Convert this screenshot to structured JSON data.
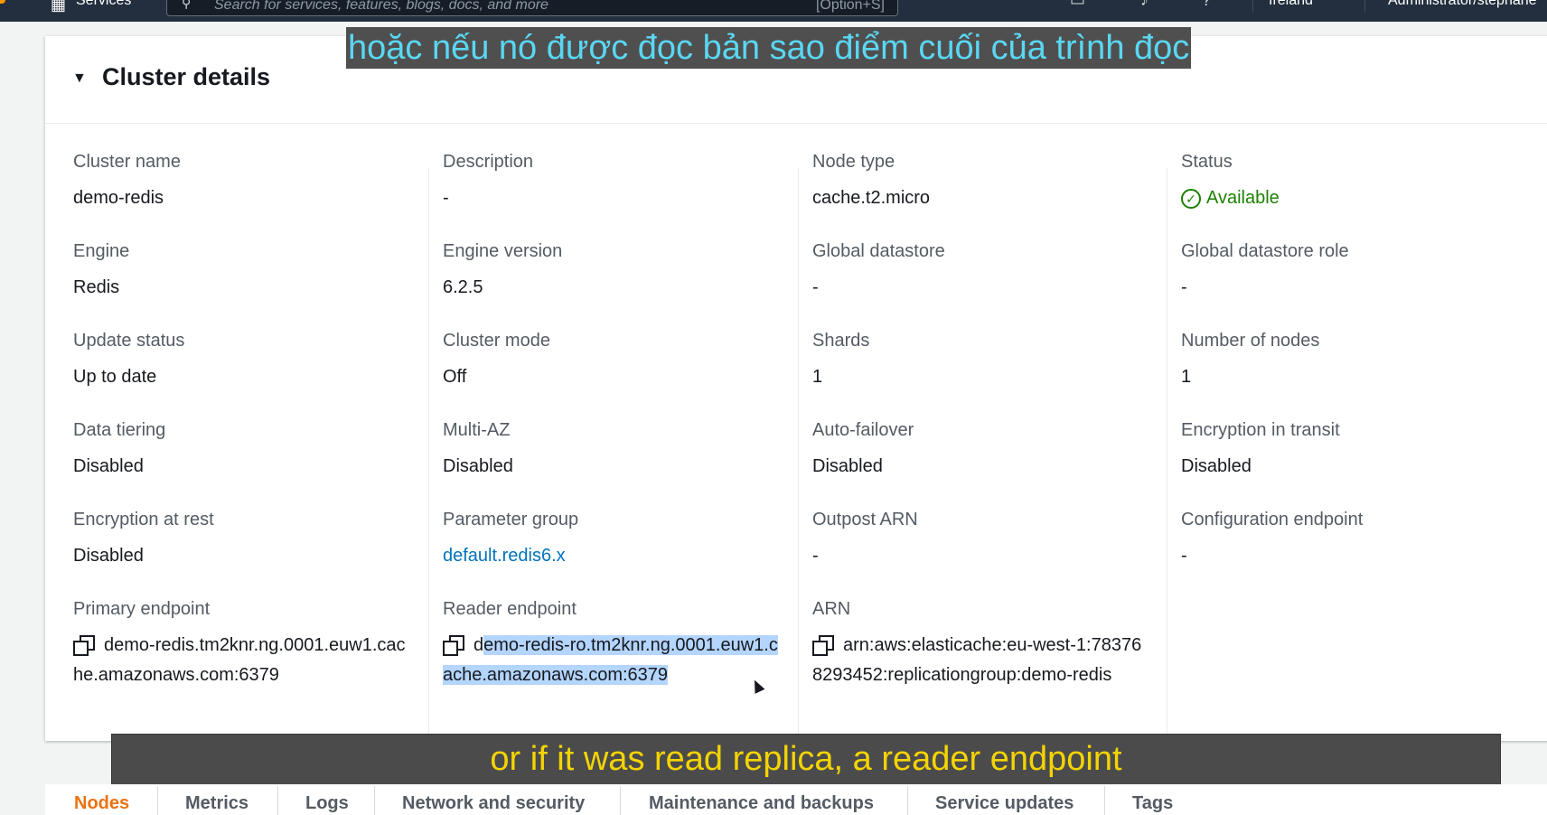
{
  "topnav": {
    "services_label": "Services",
    "search_placeholder": "Search for services, features, blogs, docs, and more",
    "search_shortcut": "[Option+S]",
    "region": "Ireland",
    "account": "Administrator/stephane"
  },
  "subtitles": {
    "top": "hoặc nếu nó được đọc bản sao điểm cuối của trình đọc",
    "bottom": "or if it was read replica, a reader endpoint"
  },
  "cluster_details": {
    "title": "Cluster details",
    "columns": [
      [
        {
          "label": "Cluster name",
          "value": "demo-redis"
        },
        {
          "label": "Engine",
          "value": "Redis"
        },
        {
          "label": "Update status",
          "value": "Up to date"
        },
        {
          "label": "Data tiering",
          "value": "Disabled"
        },
        {
          "label": "Encryption at rest",
          "value": "Disabled"
        },
        {
          "label": "Primary endpoint",
          "value": "demo-redis.tm2knr.ng.0001.euw1.cache.amazonaws.com:6379"
        }
      ],
      [
        {
          "label": "Description",
          "value": "-"
        },
        {
          "label": "Engine version",
          "value": "6.2.5"
        },
        {
          "label": "Cluster mode",
          "value": "Off"
        },
        {
          "label": "Multi-AZ",
          "value": "Disabled"
        },
        {
          "label": "Parameter group",
          "value": "default.redis6.x"
        },
        {
          "label": "Reader endpoint",
          "value_plain": "d",
          "value_selected": "emo-redis-ro.tm2knr.ng.0001.euw1.cache.amazonaws.com:6379"
        }
      ],
      [
        {
          "label": "Node type",
          "value": "cache.t2.micro"
        },
        {
          "label": "Global datastore",
          "value": "-"
        },
        {
          "label": "Shards",
          "value": "1"
        },
        {
          "label": "Auto-failover",
          "value": "Disabled"
        },
        {
          "label": "Outpost ARN",
          "value": "-"
        },
        {
          "label": "ARN",
          "value": "arn:aws:elasticache:eu-west-1:783768293452:replicationgroup:demo-redis"
        }
      ],
      [
        {
          "label": "Status",
          "value": "Available"
        },
        {
          "label": "Global datastore role",
          "value": "-"
        },
        {
          "label": "Number of nodes",
          "value": "1"
        },
        {
          "label": "Encryption in transit",
          "value": "Disabled"
        },
        {
          "label": "Configuration endpoint",
          "value": "-"
        }
      ]
    ]
  },
  "tabs": [
    "Nodes",
    "Metrics",
    "Logs",
    "Network and security",
    "Maintenance and backups",
    "Service updates",
    "Tags"
  ],
  "colors": {
    "accent": "#ec7211",
    "link": "#0073bb",
    "status_ok": "#1d8102",
    "nav_bg": "#232f3e"
  }
}
